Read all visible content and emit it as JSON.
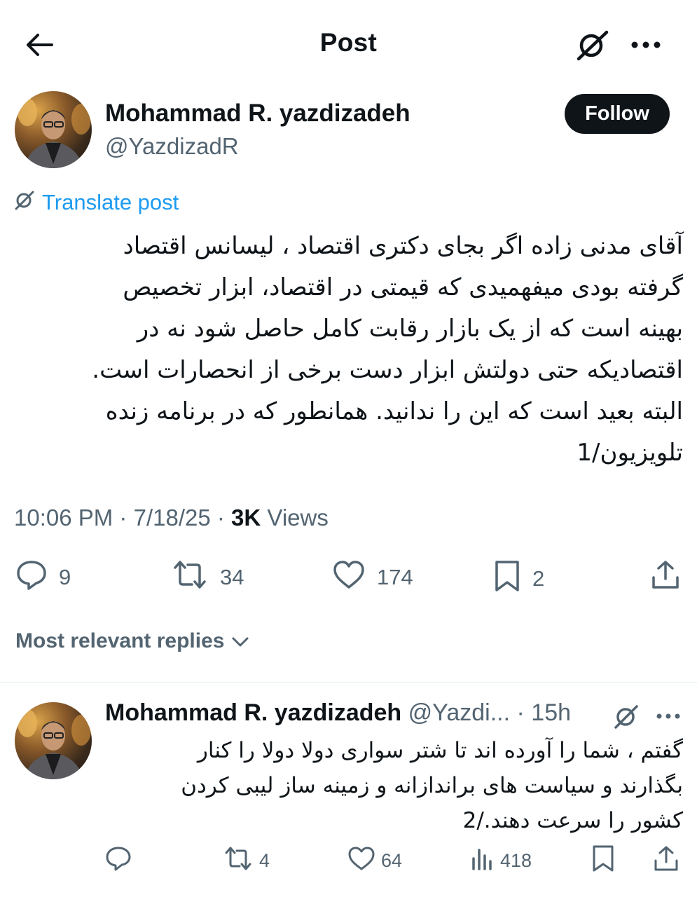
{
  "header": {
    "title": "Post"
  },
  "post": {
    "author_name": "Mohammad R. yazdizadeh",
    "author_handle": "@YazdizadR",
    "follow_label": "Follow",
    "translate_label": "Translate post",
    "body_lines": [
      "آقای مدنی زاده اگر بجای دکتری اقتصاد ، لیسانس اقتصاد",
      "گرفته بودی میفهمیدی که قیمتی در اقتصاد، ابزار تخصیص",
      "بهینه است که از یک بازار رقابت کامل حاصل شود نه در",
      "اقتصادیکه حتی  دولتش ابزار دست برخی از انحصارات است.",
      "البته بعید است که این را ندانید. همانطور که در برنامه زنده",
      "تلویزیون/1"
    ],
    "time": "10:06 PM",
    "date": "7/18/25",
    "views_count": "3K",
    "views_label": "Views",
    "replies": "9",
    "reposts": "34",
    "likes": "174",
    "bookmarks": "2"
  },
  "replies_filter": {
    "label": "Most relevant replies"
  },
  "reply": {
    "author_name": "Mohammad R. yazdizadeh",
    "author_handle": "@Yazdi...",
    "time": "15h",
    "body_lines": [
      "گفتم ، شما را آورده اند تا شتر سواری دولا دولا را کنار",
      "بگذارند  و سیاست های براندازانه و زمینه ساز لیبی کردن",
      "کشور را سرعت دهند./2"
    ],
    "reposts": "4",
    "likes": "64",
    "views": "418"
  }
}
